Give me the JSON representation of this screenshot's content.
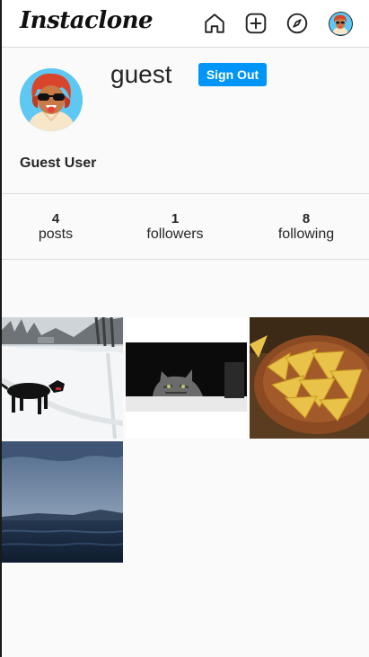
{
  "app": {
    "title": "Instaclone"
  },
  "nav": {
    "icons": [
      "home-icon",
      "new-post-icon",
      "explore-compass-icon",
      "profile-avatar-icon"
    ]
  },
  "profile": {
    "username": "guest",
    "sign_out_label": "Sign Out",
    "full_name": "Guest User"
  },
  "stats": [
    {
      "count": "4",
      "label": "posts"
    },
    {
      "count": "1",
      "label": "followers"
    },
    {
      "count": "8",
      "label": "following"
    }
  ],
  "posts": [
    {
      "name": "post-dog-in-snow"
    },
    {
      "name": "post-cat-on-blanket"
    },
    {
      "name": "post-tortilla-chips-bowl"
    },
    {
      "name": "post-sea-under-clouds"
    }
  ],
  "colors": {
    "accent": "#0095f6",
    "divider": "#dbdbdb",
    "background": "#fafafa"
  }
}
